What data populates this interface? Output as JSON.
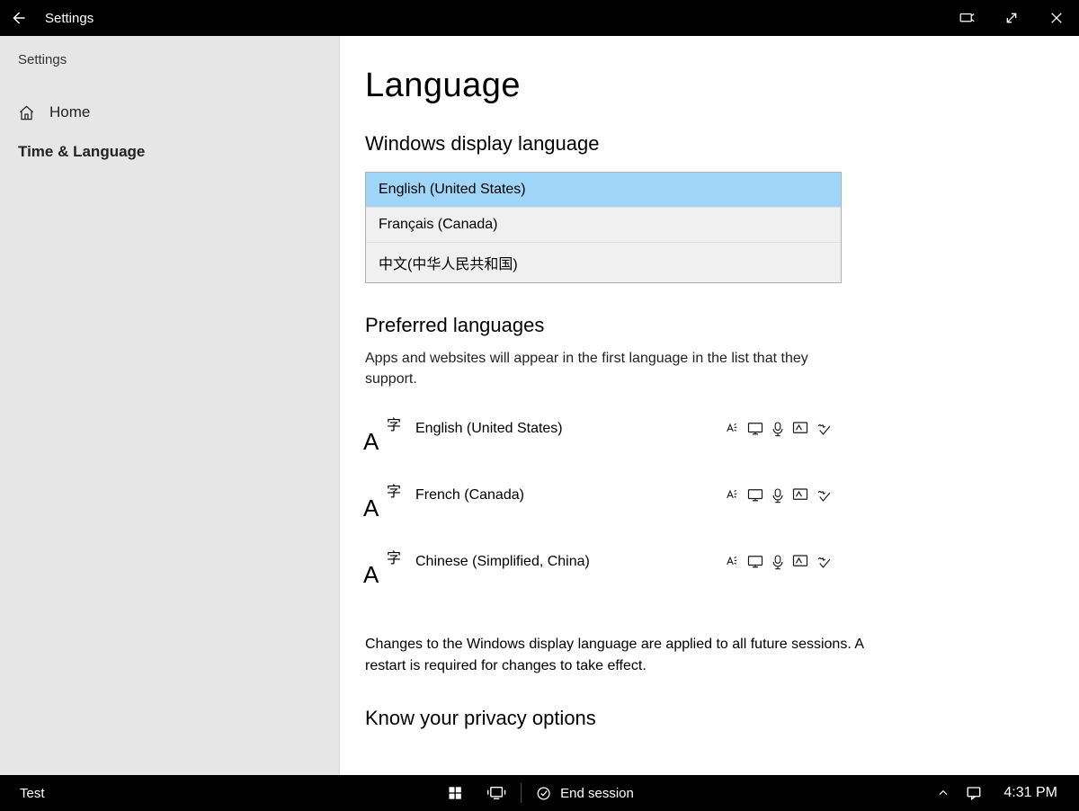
{
  "titlebar": {
    "title": "Settings"
  },
  "sidebar": {
    "crumb": "Settings",
    "home": "Home",
    "section": "Time & Language"
  },
  "page": {
    "heading": "Language",
    "display_heading": "Windows display language",
    "display_options": {
      "0": "English (United States)",
      "1": "Français (Canada)",
      "2": "中文(中华人民共和国)"
    },
    "preferred_heading": "Preferred languages",
    "preferred_desc": "Apps and websites will appear in the first language in the list that they support.",
    "preferred": {
      "0": "English (United States)",
      "1": "French (Canada)",
      "2": "Chinese (Simplified, China)"
    },
    "note": "Changes to the Windows display language are applied to all future sessions. A restart is required for changes to take effect.",
    "privacy_heading": "Know your privacy options"
  },
  "taskbar": {
    "label": "Test",
    "end_session": "End session",
    "clock": "4:31 PM"
  }
}
